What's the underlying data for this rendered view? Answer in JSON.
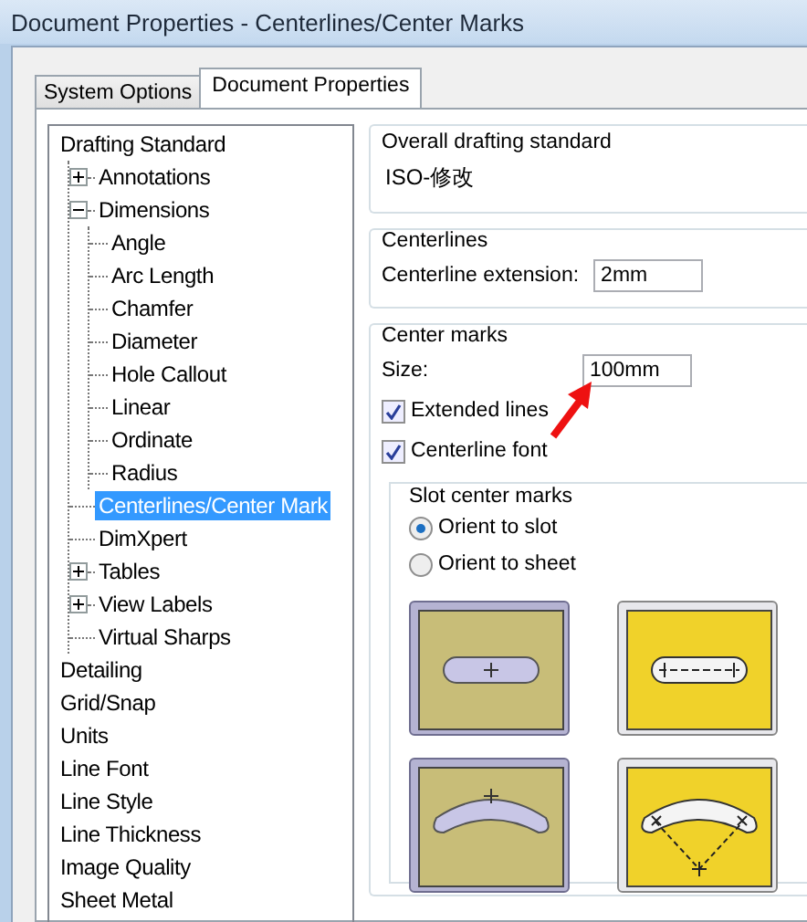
{
  "window": {
    "title": "Document Properties - Centerlines/Center Marks"
  },
  "tabs": [
    {
      "label": "System Options",
      "selected": false
    },
    {
      "label": "Document Properties",
      "selected": true
    }
  ],
  "tree": [
    {
      "label": "Drafting Standard",
      "selected": false,
      "children": [
        {
          "label": "Annotations",
          "selected": false,
          "expanded": false
        },
        {
          "label": "Dimensions",
          "selected": false,
          "expanded": true,
          "children": [
            {
              "label": "Angle",
              "selected": false
            },
            {
              "label": "Arc Length",
              "selected": false
            },
            {
              "label": "Chamfer",
              "selected": false
            },
            {
              "label": "Diameter",
              "selected": false
            },
            {
              "label": "Hole Callout",
              "selected": false
            },
            {
              "label": "Linear",
              "selected": false
            },
            {
              "label": "Ordinate",
              "selected": false
            },
            {
              "label": "Radius",
              "selected": false
            }
          ]
        },
        {
          "label": "Centerlines/Center Mark",
          "selected": true
        },
        {
          "label": "DimXpert",
          "selected": false
        },
        {
          "label": "Tables",
          "selected": false,
          "expanded": false
        },
        {
          "label": "View Labels",
          "selected": false,
          "expanded": false
        },
        {
          "label": "Virtual Sharps",
          "selected": false
        }
      ]
    },
    {
      "label": "Detailing",
      "selected": false
    },
    {
      "label": "Grid/Snap",
      "selected": false
    },
    {
      "label": "Units",
      "selected": false
    },
    {
      "label": "Line Font",
      "selected": false
    },
    {
      "label": "Line Style",
      "selected": false
    },
    {
      "label": "Line Thickness",
      "selected": false
    },
    {
      "label": "Image Quality",
      "selected": false
    },
    {
      "label": "Sheet Metal",
      "selected": false
    }
  ],
  "overall": {
    "title": "Overall drafting standard",
    "value": "ISO-修改"
  },
  "centerlines": {
    "title": "Centerlines",
    "label": "Centerline extension:",
    "value": "2mm"
  },
  "center_marks": {
    "title": "Center marks",
    "size_label": "Size:",
    "size_value": "100mm",
    "checkboxes": [
      {
        "label": "Extended lines",
        "checked": true
      },
      {
        "label": "Centerline font",
        "checked": true
      }
    ],
    "slot": {
      "title": "Slot center marks",
      "radios": [
        {
          "label": "Orient to slot",
          "selected": true
        },
        {
          "label": "Orient to sheet",
          "selected": false
        }
      ],
      "buttons": [
        {
          "kind": "straight-single",
          "selected": true
        },
        {
          "kind": "straight-extended",
          "selected": false
        },
        {
          "kind": "arc-single",
          "selected": true
        },
        {
          "kind": "arc-extended",
          "selected": false
        }
      ]
    }
  }
}
